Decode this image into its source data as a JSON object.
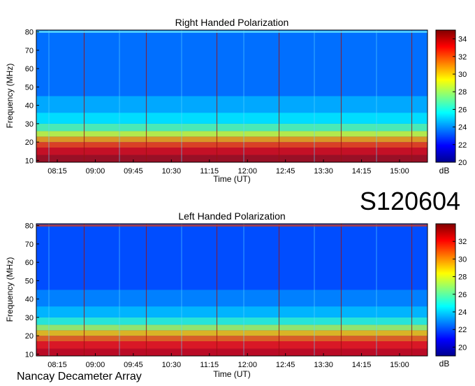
{
  "code": "S120604",
  "footer": "Nancay Decameter Array",
  "colors": {
    "cmap": [
      "#00008f",
      "#0000ff",
      "#0080ff",
      "#00ffff",
      "#80ff80",
      "#ffff00",
      "#ff8000",
      "#ff0000",
      "#800000"
    ]
  },
  "chart_data": [
    {
      "type": "heatmap",
      "title": "Right Handed Polarization",
      "xlabel": "Time (UT)",
      "ylabel": "Frequency (MHz)",
      "x_ticks": [
        "08:15",
        "09:00",
        "09:45",
        "10:30",
        "11:15",
        "12:00",
        "12:45",
        "13:30",
        "14:15",
        "15:00"
      ],
      "y_ticks": [
        10,
        20,
        30,
        40,
        50,
        60,
        70,
        80
      ],
      "ylim": [
        9,
        81
      ],
      "colorbar": {
        "label": "dB",
        "ticks": [
          20,
          22,
          24,
          26,
          28,
          30,
          32,
          34
        ],
        "range": [
          20,
          35
        ]
      },
      "background_db": 23.5
    },
    {
      "type": "heatmap",
      "title": "Left Handed Polarization",
      "xlabel": "Time (UT)",
      "ylabel": "Frequency (MHz)",
      "x_ticks": [
        "08:15",
        "09:00",
        "09:45",
        "10:30",
        "11:15",
        "12:00",
        "12:45",
        "13:30",
        "14:15",
        "15:00"
      ],
      "y_ticks": [
        10,
        20,
        30,
        40,
        50,
        60,
        70,
        80
      ],
      "ylim": [
        9,
        81
      ],
      "colorbar": {
        "label": "dB",
        "ticks": [
          20,
          22,
          24,
          26,
          28,
          30,
          32
        ],
        "range": [
          19,
          34
        ]
      },
      "background_db": 22
    }
  ]
}
